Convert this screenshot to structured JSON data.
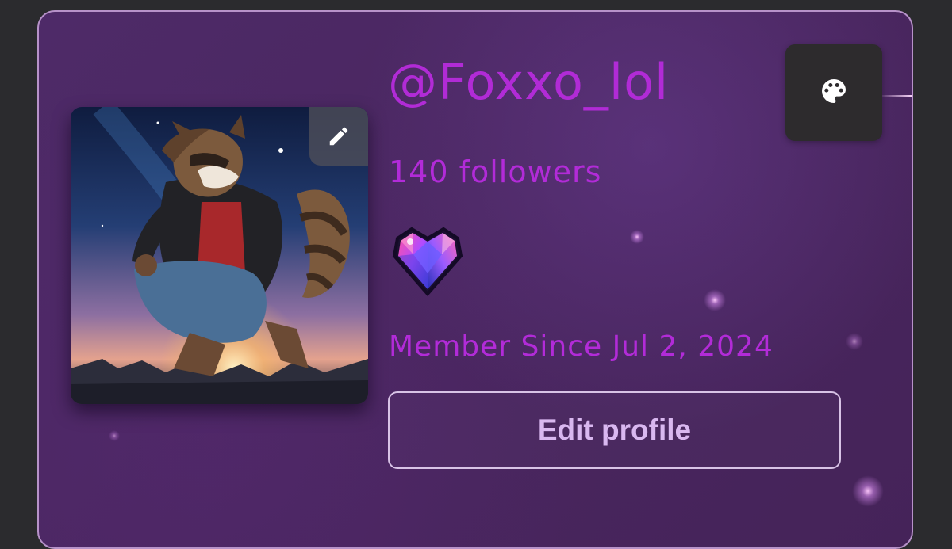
{
  "profile": {
    "username": "@Foxxo_lol",
    "followers_text": "140 followers",
    "member_since_text": "Member Since Jul 2, 2024",
    "edit_profile_label": "Edit profile"
  },
  "icons": {
    "edit_avatar": "pencil-icon",
    "theme": "palette-icon",
    "badge": "gem-heart-icon"
  },
  "colors": {
    "accent_text": "#b22bd8",
    "card_background": "#4b2862",
    "card_border": "#b792c9",
    "button_text": "#d9b8f0",
    "theme_button_bg": "#2d2b2d"
  }
}
